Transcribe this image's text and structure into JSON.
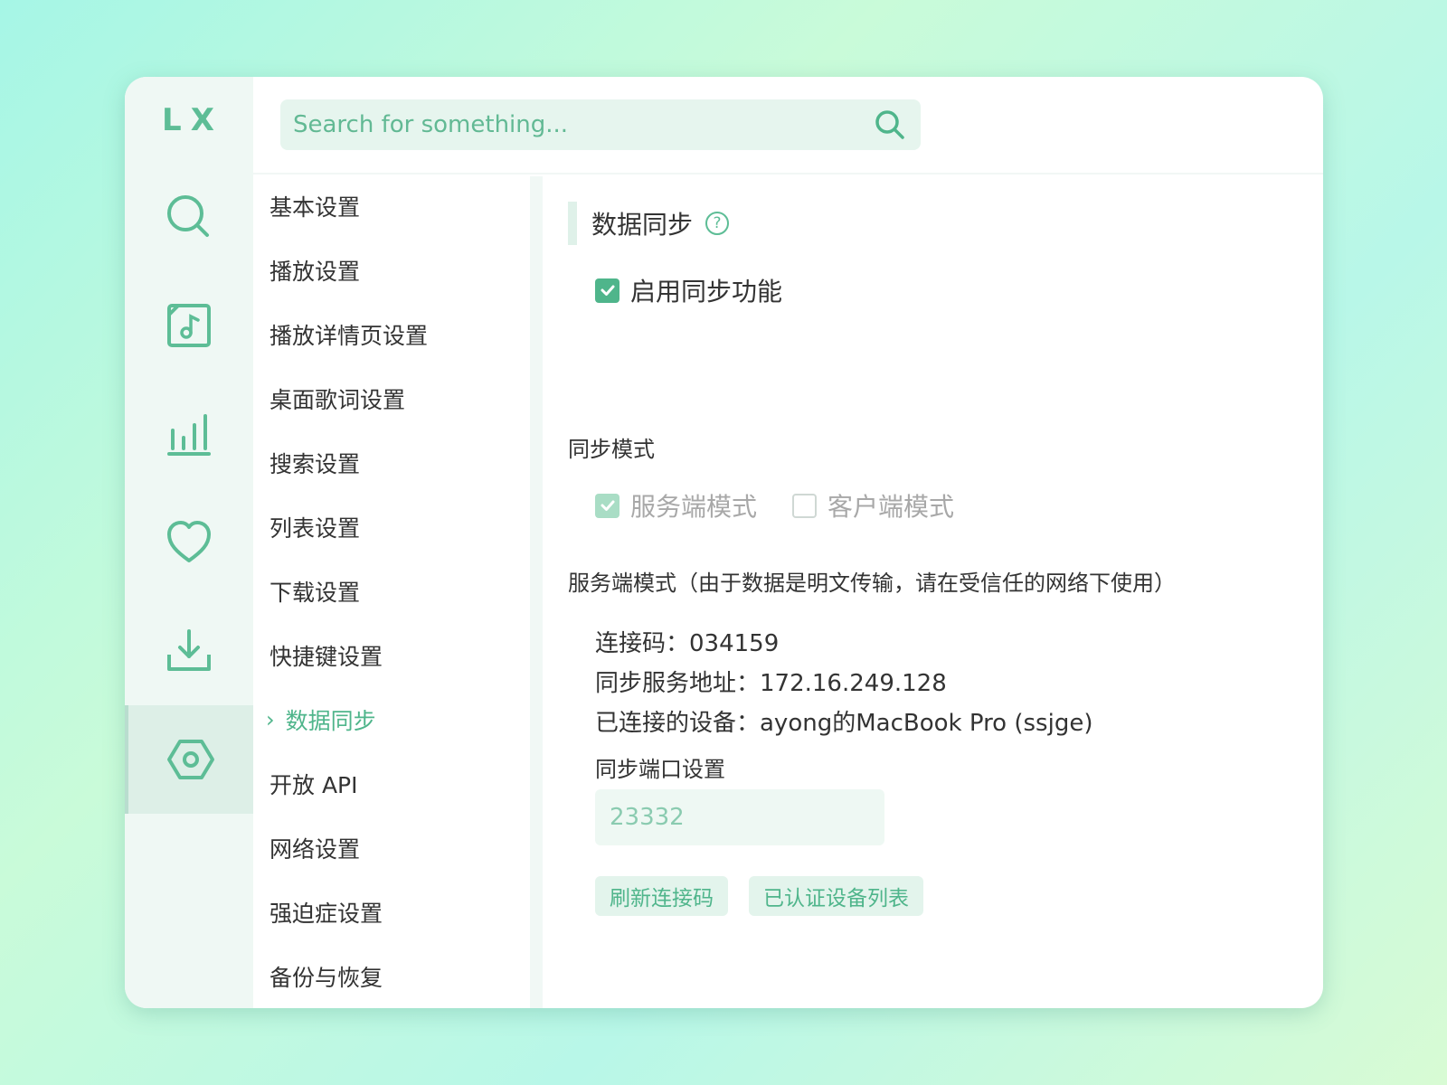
{
  "app": {
    "logo": "LX"
  },
  "search": {
    "placeholder": "Search for something..."
  },
  "rail": {
    "items": [
      {
        "icon": "search-icon"
      },
      {
        "icon": "music-file-icon"
      },
      {
        "icon": "bar-chart-icon"
      },
      {
        "icon": "heart-icon"
      },
      {
        "icon": "download-icon"
      },
      {
        "icon": "settings-icon",
        "active": true
      }
    ]
  },
  "menu": {
    "items": [
      "基本设置",
      "播放设置",
      "播放详情页设置",
      "桌面歌词设置",
      "搜索设置",
      "列表设置",
      "下载设置",
      "快捷键设置",
      "数据同步",
      "开放 API",
      "网络设置",
      "强迫症设置",
      "备份与恢复"
    ],
    "active_label": "数据同步",
    "active_chevron": "›"
  },
  "content": {
    "title": "数据同步",
    "help_icon": "?",
    "enable_sync": {
      "label": "启用同步功能",
      "checked": true
    },
    "mode_heading": "同步模式",
    "server_mode": {
      "label": "服务端模式",
      "checked": true,
      "disabled": true
    },
    "client_mode": {
      "label": "客户端模式",
      "checked": false,
      "disabled": true
    },
    "server_desc": "服务端模式（由于数据是明文传输，请在受信任的网络下使用）",
    "connection_code": "连接码：034159",
    "server_address": "同步服务地址：172.16.249.128",
    "connected_device": "已连接的设备：ayong的MacBook Pro (ssjge)",
    "port_heading": "同步端口设置",
    "port_value": "23332",
    "refresh_button": "刷新连接码",
    "devices_button": "已认证设备列表"
  },
  "colors": {
    "accent": "#4fb58b",
    "rail_bg": "#eff8f4",
    "input_bg": "#e6f5ee"
  }
}
